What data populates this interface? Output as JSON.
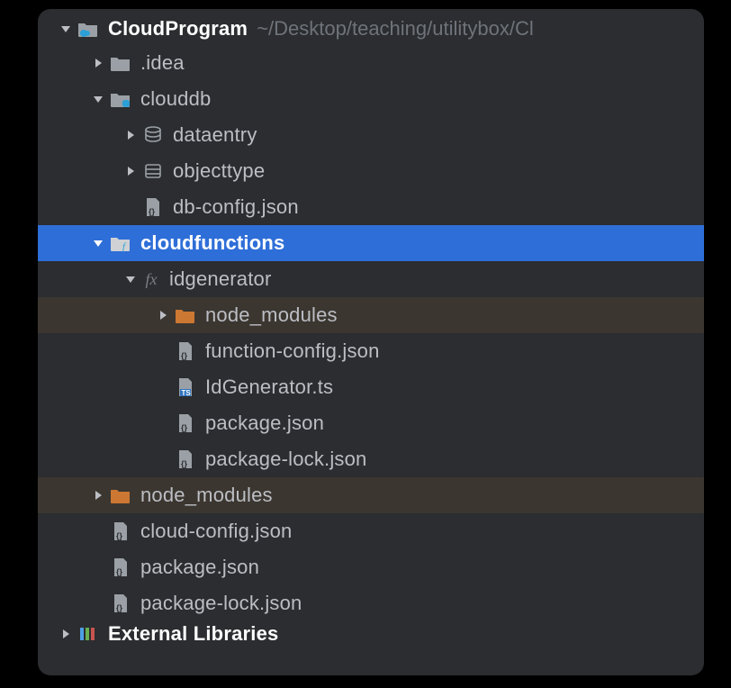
{
  "root": {
    "name": "CloudProgram",
    "path": "~/Desktop/teaching/utilitybox/Cl",
    "children": [
      {
        "name": ".idea",
        "icon": "folder"
      },
      {
        "name": "clouddb",
        "icon": "folder-db",
        "expanded": true,
        "children": [
          {
            "name": "dataentry",
            "icon": "db-stack"
          },
          {
            "name": "objecttype",
            "icon": "db-row"
          },
          {
            "name": "db-config.json",
            "icon": "json"
          }
        ]
      },
      {
        "name": "cloudfunctions",
        "icon": "folder-fn",
        "expanded": true,
        "selected": true,
        "children": [
          {
            "name": "idgenerator",
            "icon": "fx",
            "expanded": true,
            "children": [
              {
                "name": "node_modules",
                "icon": "folder-orange",
                "dim": true
              },
              {
                "name": "function-config.json",
                "icon": "json"
              },
              {
                "name": "IdGenerator.ts",
                "icon": "ts"
              },
              {
                "name": "package.json",
                "icon": "json"
              },
              {
                "name": "package-lock.json",
                "icon": "json"
              }
            ]
          }
        ]
      },
      {
        "name": "node_modules",
        "icon": "folder-orange",
        "dim": true
      },
      {
        "name": "cloud-config.json",
        "icon": "json"
      },
      {
        "name": "package.json",
        "icon": "json"
      },
      {
        "name": "package-lock.json",
        "icon": "json"
      }
    ]
  },
  "footer": "External Libraries"
}
